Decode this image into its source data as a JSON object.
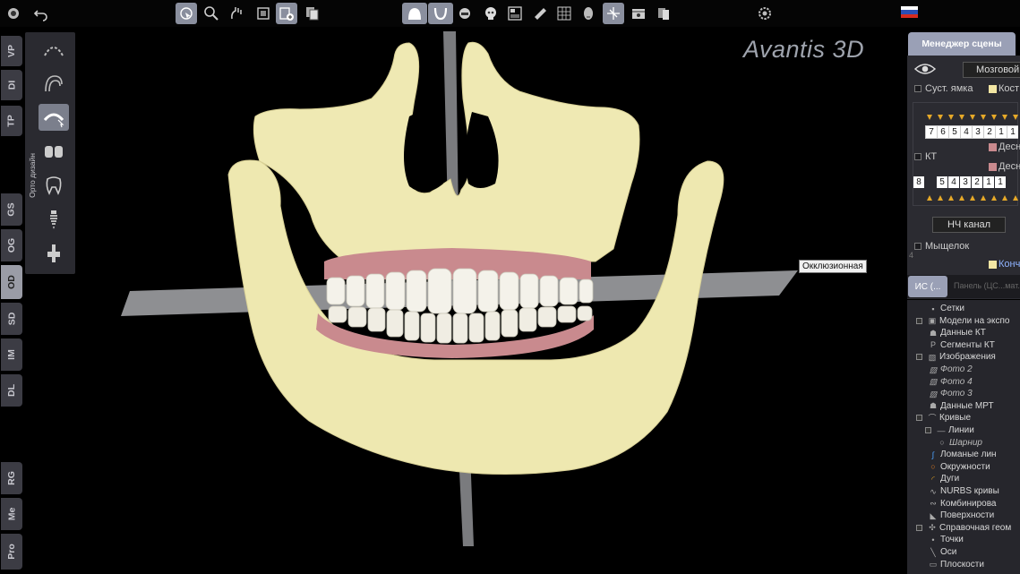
{
  "brand": {
    "name": "Avantis 3D"
  },
  "toolbar": {
    "groups": [
      {
        "icons": [
          "app-menu-icon",
          "undo-icon"
        ]
      },
      {
        "icons": [
          "select-cursor-icon",
          "zoom-icon",
          "pan-icon",
          "layer-icon",
          "add-object-icon",
          "stack-icon"
        ]
      },
      {
        "icons": [
          "jaw-view-icon",
          "arch-view-icon",
          "tooth-view-icon"
        ]
      },
      {
        "icons": [
          "skull-icon",
          "panel-icon",
          "ruler-icon",
          "grid-icon",
          "head-icon",
          "crosshair-icon",
          "film-icon",
          "palette-icon"
        ]
      },
      {
        "icons": [
          "settings-icon"
        ]
      }
    ],
    "language_flag": "ru-flag-icon",
    "colors": {
      "active": "#8a8f9e"
    }
  },
  "left_tabs": [
    {
      "label": "VP",
      "active": false
    },
    {
      "label": "DI",
      "active": false
    },
    {
      "label": "TP",
      "active": false
    },
    {
      "label": "GS",
      "active": false
    },
    {
      "label": "OG",
      "active": false
    },
    {
      "label": "OD",
      "active": true
    },
    {
      "label": "SD",
      "active": false
    },
    {
      "label": "IM",
      "active": false
    },
    {
      "label": "DL",
      "active": false
    },
    {
      "label": "RG",
      "active": false
    },
    {
      "label": "Me",
      "active": false
    },
    {
      "label": "Pro",
      "active": false
    }
  ],
  "ortho_panel": {
    "label": "Орто дизайн",
    "tools": [
      "arch-wire-icon",
      "aligner-set-icon",
      "arch-select-icon",
      "brackets-icon",
      "tooth-icon",
      "implant-icon",
      "attachment-icon"
    ]
  },
  "viewport": {
    "plane_label": "Окклюзионная",
    "colors": {
      "bone": "#eee8b0",
      "gum": "#c98a8e",
      "teeth": "#f4f2ea",
      "plane": "#8e8f92"
    }
  },
  "scene_manager": {
    "title": "Менеджер сцены",
    "view_dropdown": "Мозговой",
    "joint_fossa": "Суст. ямка",
    "bone_label": "Кост",
    "upper_teeth": [
      "7",
      "6",
      "5",
      "4",
      "3",
      "2",
      "1",
      "1"
    ],
    "gum_upper": "Десн",
    "ct_label": "КТ",
    "gum_lower": "Десн",
    "lower_teeth": [
      "8",
      "",
      "5",
      "4",
      "3",
      "2",
      "1",
      "1"
    ],
    "nerve_button": "НЧ канал",
    "condyle": "Мыщелок",
    "row_number": "4",
    "small_label": "Конч",
    "tabs": [
      {
        "label": "ИС (...",
        "active": true
      },
      {
        "label": "Панель (ЦС...мат.Кость)",
        "active": false
      }
    ]
  },
  "tree": [
    {
      "label": "Сетки",
      "level": 0,
      "icon": "grid-square-icon",
      "expander": false,
      "italic": false
    },
    {
      "label": "Модели на экспо",
      "level": 0,
      "icon": "model-icon",
      "expander": true,
      "italic": false
    },
    {
      "label": "Данные КТ",
      "level": 0,
      "icon": "ct-data-icon",
      "expander": false,
      "italic": false
    },
    {
      "label": "Сегменты КТ",
      "level": 0,
      "icon": "segment-icon",
      "expander": false,
      "italic": false
    },
    {
      "label": "Изображения",
      "level": 0,
      "icon": "image-icon",
      "expander": true,
      "italic": false
    },
    {
      "label": "Фото 2",
      "level": 1,
      "icon": "image-icon",
      "expander": false,
      "italic": true
    },
    {
      "label": "Фото 4",
      "level": 1,
      "icon": "image-icon",
      "expander": false,
      "italic": true
    },
    {
      "label": "Фото 3",
      "level": 1,
      "icon": "image-icon",
      "expander": false,
      "italic": true
    },
    {
      "label": "Данные МРТ",
      "level": 0,
      "icon": "mri-icon",
      "expander": false,
      "italic": false
    },
    {
      "label": "Кривые",
      "level": 0,
      "icon": "curve-icon",
      "expander": true,
      "italic": false
    },
    {
      "label": "Линии",
      "level": 1,
      "icon": "line-icon",
      "expander": true,
      "italic": false
    },
    {
      "label": "Шарнир",
      "level": 2,
      "icon": "hinge-icon",
      "expander": false,
      "italic": true
    },
    {
      "label": "Ломаные лин",
      "level": 1,
      "icon": "polyline-icon",
      "expander": false,
      "italic": false
    },
    {
      "label": "Окружности",
      "level": 1,
      "icon": "circle-icon",
      "expander": false,
      "italic": false
    },
    {
      "label": "Дуги",
      "level": 1,
      "icon": "arc-icon",
      "expander": false,
      "italic": false
    },
    {
      "label": "NURBS кривы",
      "level": 1,
      "icon": "nurbs-icon",
      "expander": false,
      "italic": false
    },
    {
      "label": "Комбинирова",
      "level": 1,
      "icon": "combined-icon",
      "expander": false,
      "italic": false
    },
    {
      "label": "Поверхности",
      "level": 0,
      "icon": "surface-icon",
      "expander": false,
      "italic": false
    },
    {
      "label": "Справочная геом",
      "level": 0,
      "icon": "reference-geometry-icon",
      "expander": true,
      "italic": false
    },
    {
      "label": "Точки",
      "level": 1,
      "icon": "point-icon",
      "expander": false,
      "italic": false
    },
    {
      "label": "Оси",
      "level": 1,
      "icon": "axis-icon",
      "expander": false,
      "italic": false
    },
    {
      "label": "Плоскости",
      "level": 1,
      "icon": "plane-icon",
      "expander": false,
      "italic": false
    }
  ]
}
